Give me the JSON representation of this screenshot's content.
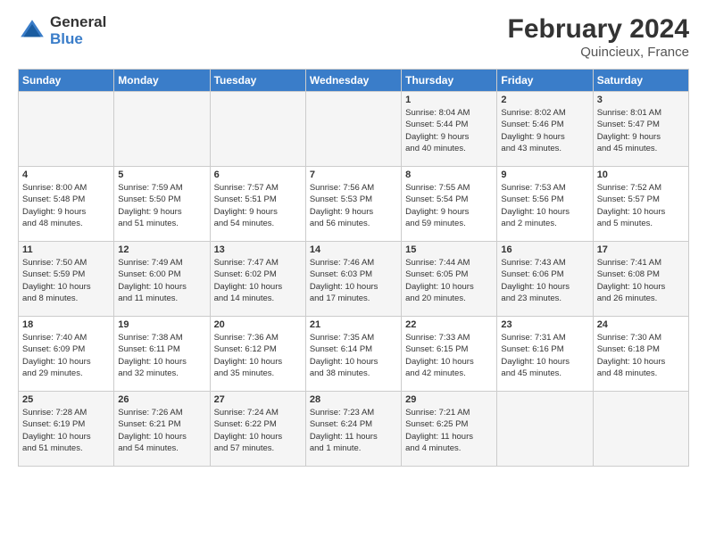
{
  "header": {
    "logo_general": "General",
    "logo_blue": "Blue",
    "month_year": "February 2024",
    "location": "Quincieux, France"
  },
  "days_of_week": [
    "Sunday",
    "Monday",
    "Tuesday",
    "Wednesday",
    "Thursday",
    "Friday",
    "Saturday"
  ],
  "weeks": [
    [
      {
        "day": "",
        "info": ""
      },
      {
        "day": "",
        "info": ""
      },
      {
        "day": "",
        "info": ""
      },
      {
        "day": "",
        "info": ""
      },
      {
        "day": "1",
        "info": "Sunrise: 8:04 AM\nSunset: 5:44 PM\nDaylight: 9 hours\nand 40 minutes."
      },
      {
        "day": "2",
        "info": "Sunrise: 8:02 AM\nSunset: 5:46 PM\nDaylight: 9 hours\nand 43 minutes."
      },
      {
        "day": "3",
        "info": "Sunrise: 8:01 AM\nSunset: 5:47 PM\nDaylight: 9 hours\nand 45 minutes."
      }
    ],
    [
      {
        "day": "4",
        "info": "Sunrise: 8:00 AM\nSunset: 5:48 PM\nDaylight: 9 hours\nand 48 minutes."
      },
      {
        "day": "5",
        "info": "Sunrise: 7:59 AM\nSunset: 5:50 PM\nDaylight: 9 hours\nand 51 minutes."
      },
      {
        "day": "6",
        "info": "Sunrise: 7:57 AM\nSunset: 5:51 PM\nDaylight: 9 hours\nand 54 minutes."
      },
      {
        "day": "7",
        "info": "Sunrise: 7:56 AM\nSunset: 5:53 PM\nDaylight: 9 hours\nand 56 minutes."
      },
      {
        "day": "8",
        "info": "Sunrise: 7:55 AM\nSunset: 5:54 PM\nDaylight: 9 hours\nand 59 minutes."
      },
      {
        "day": "9",
        "info": "Sunrise: 7:53 AM\nSunset: 5:56 PM\nDaylight: 10 hours\nand 2 minutes."
      },
      {
        "day": "10",
        "info": "Sunrise: 7:52 AM\nSunset: 5:57 PM\nDaylight: 10 hours\nand 5 minutes."
      }
    ],
    [
      {
        "day": "11",
        "info": "Sunrise: 7:50 AM\nSunset: 5:59 PM\nDaylight: 10 hours\nand 8 minutes."
      },
      {
        "day": "12",
        "info": "Sunrise: 7:49 AM\nSunset: 6:00 PM\nDaylight: 10 hours\nand 11 minutes."
      },
      {
        "day": "13",
        "info": "Sunrise: 7:47 AM\nSunset: 6:02 PM\nDaylight: 10 hours\nand 14 minutes."
      },
      {
        "day": "14",
        "info": "Sunrise: 7:46 AM\nSunset: 6:03 PM\nDaylight: 10 hours\nand 17 minutes."
      },
      {
        "day": "15",
        "info": "Sunrise: 7:44 AM\nSunset: 6:05 PM\nDaylight: 10 hours\nand 20 minutes."
      },
      {
        "day": "16",
        "info": "Sunrise: 7:43 AM\nSunset: 6:06 PM\nDaylight: 10 hours\nand 23 minutes."
      },
      {
        "day": "17",
        "info": "Sunrise: 7:41 AM\nSunset: 6:08 PM\nDaylight: 10 hours\nand 26 minutes."
      }
    ],
    [
      {
        "day": "18",
        "info": "Sunrise: 7:40 AM\nSunset: 6:09 PM\nDaylight: 10 hours\nand 29 minutes."
      },
      {
        "day": "19",
        "info": "Sunrise: 7:38 AM\nSunset: 6:11 PM\nDaylight: 10 hours\nand 32 minutes."
      },
      {
        "day": "20",
        "info": "Sunrise: 7:36 AM\nSunset: 6:12 PM\nDaylight: 10 hours\nand 35 minutes."
      },
      {
        "day": "21",
        "info": "Sunrise: 7:35 AM\nSunset: 6:14 PM\nDaylight: 10 hours\nand 38 minutes."
      },
      {
        "day": "22",
        "info": "Sunrise: 7:33 AM\nSunset: 6:15 PM\nDaylight: 10 hours\nand 42 minutes."
      },
      {
        "day": "23",
        "info": "Sunrise: 7:31 AM\nSunset: 6:16 PM\nDaylight: 10 hours\nand 45 minutes."
      },
      {
        "day": "24",
        "info": "Sunrise: 7:30 AM\nSunset: 6:18 PM\nDaylight: 10 hours\nand 48 minutes."
      }
    ],
    [
      {
        "day": "25",
        "info": "Sunrise: 7:28 AM\nSunset: 6:19 PM\nDaylight: 10 hours\nand 51 minutes."
      },
      {
        "day": "26",
        "info": "Sunrise: 7:26 AM\nSunset: 6:21 PM\nDaylight: 10 hours\nand 54 minutes."
      },
      {
        "day": "27",
        "info": "Sunrise: 7:24 AM\nSunset: 6:22 PM\nDaylight: 10 hours\nand 57 minutes."
      },
      {
        "day": "28",
        "info": "Sunrise: 7:23 AM\nSunset: 6:24 PM\nDaylight: 11 hours\nand 1 minute."
      },
      {
        "day": "29",
        "info": "Sunrise: 7:21 AM\nSunset: 6:25 PM\nDaylight: 11 hours\nand 4 minutes."
      },
      {
        "day": "",
        "info": ""
      },
      {
        "day": "",
        "info": ""
      }
    ]
  ]
}
